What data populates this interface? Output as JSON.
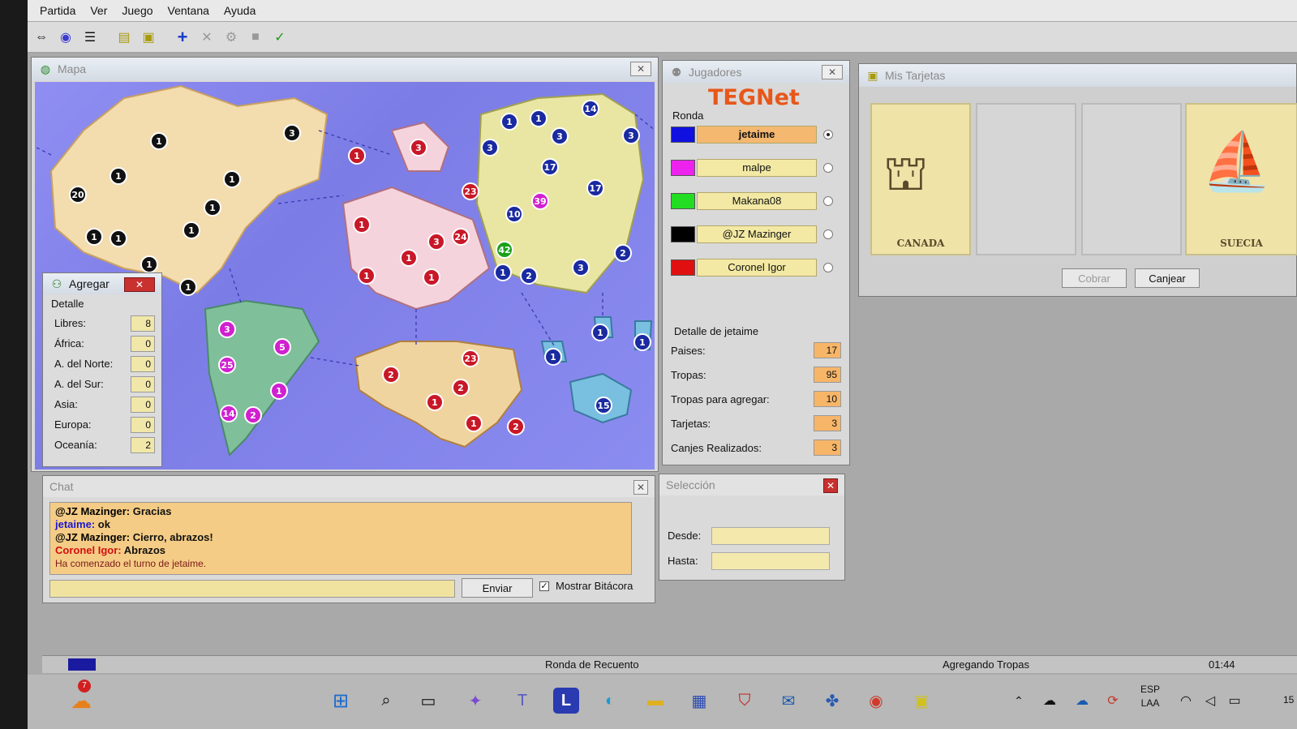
{
  "menu": [
    "Partida",
    "Ver",
    "Juego",
    "Ventana",
    "Ayuda"
  ],
  "toolbar": {
    "icons": [
      "connect-icon",
      "globe-icon",
      "list-icon",
      "message-icon",
      "help-card-icon",
      "add-icon",
      "cancel-icon",
      "settings-icon",
      "stop-icon",
      "check-icon"
    ]
  },
  "map_window": {
    "title": "Mapa",
    "armies": [
      {
        "n": "1",
        "color": "black"
      },
      {
        "n": "3",
        "color": "black"
      },
      {
        "n": "1",
        "color": "black"
      },
      {
        "n": "20",
        "color": "black"
      },
      {
        "n": "1",
        "color": "black"
      },
      {
        "n": "1",
        "color": "black"
      },
      {
        "n": "1",
        "color": "black"
      },
      {
        "n": "1",
        "color": "black"
      },
      {
        "n": "1",
        "color": "black"
      },
      {
        "n": "1",
        "color": "black"
      },
      {
        "n": "1",
        "color": "black"
      },
      {
        "n": "3",
        "color": "magenta"
      },
      {
        "n": "5",
        "color": "magenta"
      },
      {
        "n": "25",
        "color": "magenta"
      },
      {
        "n": "1",
        "color": "magenta"
      },
      {
        "n": "14",
        "color": "magenta"
      },
      {
        "n": "2",
        "color": "magenta"
      },
      {
        "n": "39",
        "color": "magenta"
      },
      {
        "n": "1",
        "color": "red"
      },
      {
        "n": "3",
        "color": "red"
      },
      {
        "n": "1",
        "color": "red"
      },
      {
        "n": "23",
        "color": "red"
      },
      {
        "n": "3",
        "color": "red"
      },
      {
        "n": "24",
        "color": "red"
      },
      {
        "n": "1",
        "color": "red"
      },
      {
        "n": "1",
        "color": "red"
      },
      {
        "n": "1",
        "color": "red"
      },
      {
        "n": "2",
        "color": "red"
      },
      {
        "n": "23",
        "color": "red"
      },
      {
        "n": "2",
        "color": "red"
      },
      {
        "n": "1",
        "color": "red"
      },
      {
        "n": "1",
        "color": "red"
      },
      {
        "n": "2",
        "color": "red"
      },
      {
        "n": "1",
        "color": "blue"
      },
      {
        "n": "1",
        "color": "blue"
      },
      {
        "n": "14",
        "color": "blue"
      },
      {
        "n": "3",
        "color": "blue"
      },
      {
        "n": "3",
        "color": "blue"
      },
      {
        "n": "3",
        "color": "blue"
      },
      {
        "n": "17",
        "color": "blue"
      },
      {
        "n": "17",
        "color": "blue"
      },
      {
        "n": "10",
        "color": "blue"
      },
      {
        "n": "2",
        "color": "blue"
      },
      {
        "n": "1",
        "color": "blue"
      },
      {
        "n": "2",
        "color": "blue"
      },
      {
        "n": "3",
        "color": "blue"
      },
      {
        "n": "1",
        "color": "blue"
      },
      {
        "n": "1",
        "color": "blue"
      },
      {
        "n": "1",
        "color": "blue"
      },
      {
        "n": "15",
        "color": "blue"
      },
      {
        "n": "42",
        "color": "green"
      }
    ]
  },
  "agregar": {
    "title": "Agregar",
    "group": "Detalle",
    "rows": [
      {
        "label": "Libres:",
        "value": "8"
      },
      {
        "label": "África:",
        "value": "0"
      },
      {
        "label": "A. del Norte:",
        "value": "0"
      },
      {
        "label": "A. del Sur:",
        "value": "0"
      },
      {
        "label": "Asia:",
        "value": "0"
      },
      {
        "label": "Europa:",
        "value": "0"
      },
      {
        "label": "Oceanía:",
        "value": "2"
      }
    ]
  },
  "jugadores": {
    "title": "Jugadores",
    "logo": "TEGNet",
    "ronda_label": "Ronda",
    "players": [
      {
        "name": "jetaime",
        "color": "#1010e0",
        "active": true
      },
      {
        "name": "malpe",
        "color": "#ee22ee",
        "active": false
      },
      {
        "name": "Makana08",
        "color": "#22dd22",
        "active": false
      },
      {
        "name": "@JZ Mazinger",
        "color": "#000000",
        "active": false
      },
      {
        "name": "Coronel Igor",
        "color": "#e01010",
        "active": false
      }
    ],
    "detail_title": "Detalle de jetaime",
    "details": [
      {
        "label": "Paises:",
        "value": "17"
      },
      {
        "label": "Tropas:",
        "value": "95"
      },
      {
        "label": "Tropas para agregar:",
        "value": "10"
      },
      {
        "label": "Tarjetas:",
        "value": "3"
      },
      {
        "label": "Canjes Realizados:",
        "value": "3"
      }
    ]
  },
  "tarjetas": {
    "title": "Mis Tarjetas",
    "cards": [
      {
        "name": "CANADA",
        "image": "cannon-icon"
      },
      {
        "name": "",
        "image": ""
      },
      {
        "name": "",
        "image": ""
      },
      {
        "name": "SUECIA",
        "image": "ship-icon"
      }
    ],
    "cobrar": "Cobrar",
    "canjear": "Canjear"
  },
  "chat": {
    "title": "Chat",
    "messages": [
      {
        "user": "@JZ Mazinger:",
        "text": " Gracias",
        "user_color": "#000000"
      },
      {
        "user": "jetaime:",
        "text": " ok",
        "user_color": "#1a1ad0"
      },
      {
        "user": "@JZ Mazinger:",
        "text": " Cierro, abrazos!",
        "user_color": "#000000"
      },
      {
        "user": "Coronel Igor:",
        "text": " Abrazos",
        "user_color": "#d01010"
      }
    ],
    "system_message": "Ha comenzado el turno de jetaime.",
    "send": "Enviar",
    "show_log": "Mostrar Bitácora"
  },
  "seleccion": {
    "title": "Selección",
    "desde": "Desde:",
    "hasta": "Hasta:"
  },
  "status": {
    "round": "Ronda de Recuento",
    "phase": "Agregando Tropas",
    "time": "01:44"
  },
  "taskbar": {
    "notification_count": "7",
    "lang_1": "ESP",
    "lang_2": "LAA",
    "clock_partial": "15"
  }
}
